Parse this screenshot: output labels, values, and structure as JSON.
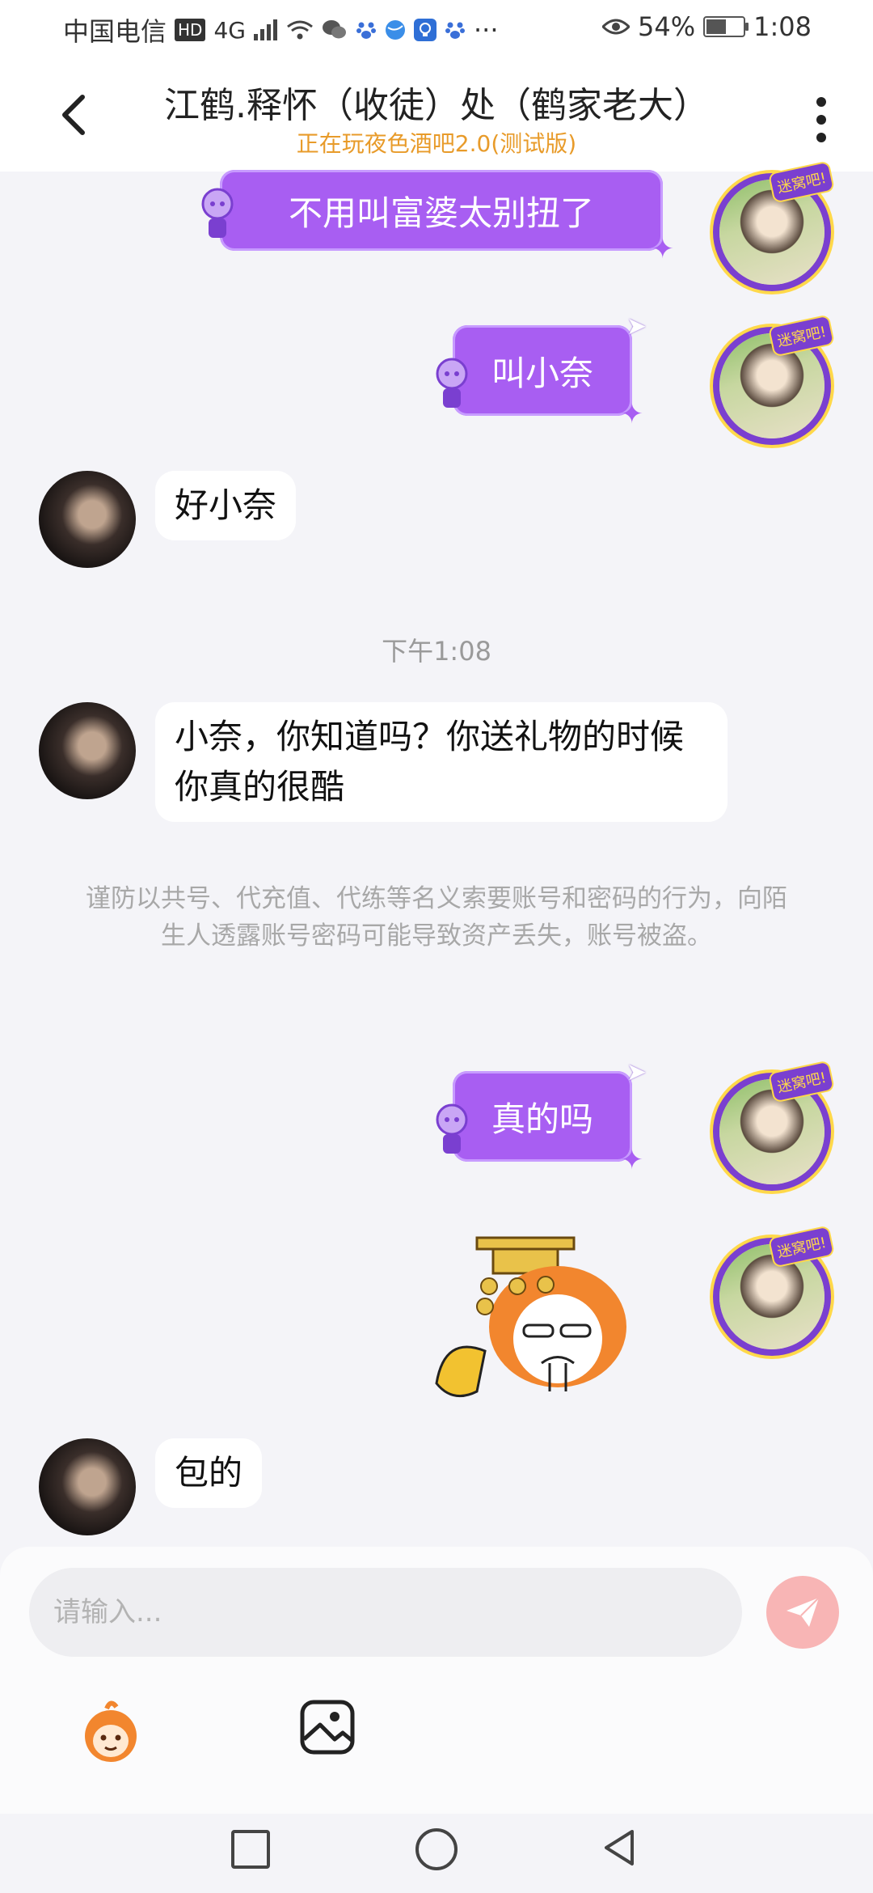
{
  "status_bar": {
    "carrier": "中国电信",
    "hd": "HD",
    "network": "4G",
    "dots": "···",
    "battery_percent": "54%",
    "battery_level": 0.54,
    "time": "1:08"
  },
  "header": {
    "title": "江鹤.释怀（收徒）处（鹤家老大）",
    "subtitle": "正在玩夜色酒吧2.0(测试版)"
  },
  "messages": [
    {
      "side": "right",
      "type": "text",
      "text": "不用叫富婆太别扭了"
    },
    {
      "side": "right",
      "type": "text",
      "text": "叫小奈"
    },
    {
      "side": "left",
      "type": "text",
      "text": "好小奈"
    },
    {
      "type": "timestamp",
      "text": "下午1:08"
    },
    {
      "side": "left",
      "type": "text",
      "text": "小奈，你知道吗？你送礼物的时候你真的很酷"
    },
    {
      "type": "notice",
      "text": "谨防以共号、代充值、代练等名义索要账号和密码的行为，向陌生人透露账号密码可能导致资产丢失，账号被盗。"
    },
    {
      "side": "right",
      "type": "text",
      "text": "真的吗"
    },
    {
      "side": "right",
      "type": "sticker",
      "sticker": "orange-mascot-salute"
    },
    {
      "side": "left",
      "type": "text",
      "text": "包的"
    }
  ],
  "avatar_badge": "迷窝吧!",
  "input": {
    "placeholder": "请输入..."
  },
  "colors": {
    "bubble_purple": "#a85ef2",
    "subtitle_orange": "#e89b2a",
    "send_button": "#f8b5b5"
  },
  "icons": {
    "back": "back-chevron-icon",
    "more": "more-vertical-icon",
    "send": "send-plane-icon",
    "emoji": "mascot-emoji-icon",
    "image": "image-icon"
  }
}
